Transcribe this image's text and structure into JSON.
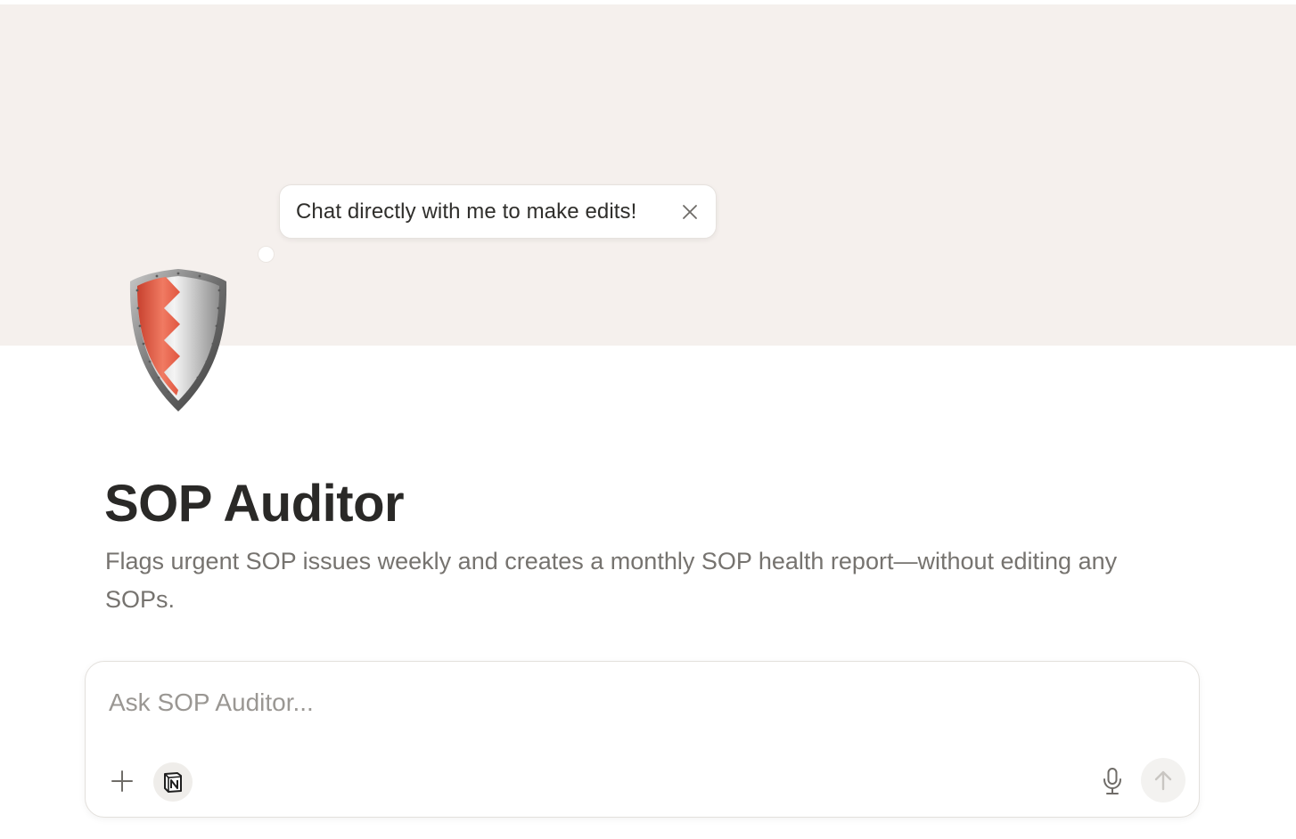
{
  "bubble": {
    "text": "Chat directly with me to make edits!",
    "close_icon": "close-icon"
  },
  "agent": {
    "icon": "shield-icon",
    "title": "SOP Auditor",
    "description": "Flags urgent SOP issues weekly and creates a monthly SOP health report—without editing any SOPs."
  },
  "composer": {
    "placeholder": "Ask SOP Auditor...",
    "value": "",
    "add_icon": "plus-icon",
    "notion_icon": "notion-icon",
    "mic_icon": "microphone-icon",
    "send_icon": "arrow-up-icon"
  },
  "colors": {
    "cover_background": "#f5f0ed",
    "shield_red": "#e8604a",
    "text_primary": "#2a2927",
    "text_secondary": "#76736f"
  }
}
